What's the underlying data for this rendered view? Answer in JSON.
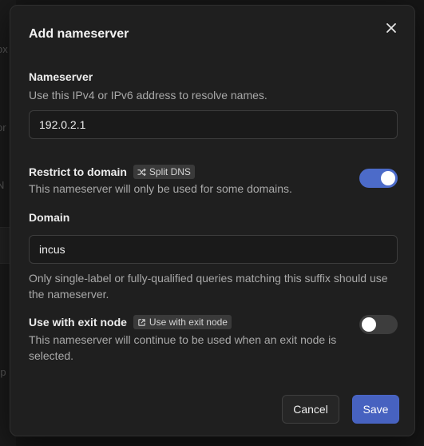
{
  "dialog": {
    "title": "Add nameserver",
    "close_icon": "close-icon"
  },
  "nameserver": {
    "label": "Nameserver",
    "help": "Use this IPv4 or IPv6 address to resolve names.",
    "value": "192.0.2.1"
  },
  "restrict": {
    "label": "Restrict to domain",
    "badge_icon": "shuffle-icon",
    "badge": "Split DNS",
    "help": "This nameserver will only be used for some domains.",
    "enabled": true
  },
  "domain": {
    "label": "Domain",
    "value": "incus",
    "help": "Only single-label or fully-qualified queries matching this suffix should use the nameserver."
  },
  "exit_node": {
    "label": "Use with exit node",
    "badge_icon": "external-link-icon",
    "badge": "Use with exit node",
    "help": "This nameserver will continue to be used when an exit node is selected.",
    "enabled": false
  },
  "buttons": {
    "cancel": "Cancel",
    "save": "Save"
  },
  "colors": {
    "accent": "#4762c0",
    "toggle_on": "#4c6bc9",
    "toggle_off": "#3d3d3d",
    "dialog_bg": "#1f1f1f"
  }
}
